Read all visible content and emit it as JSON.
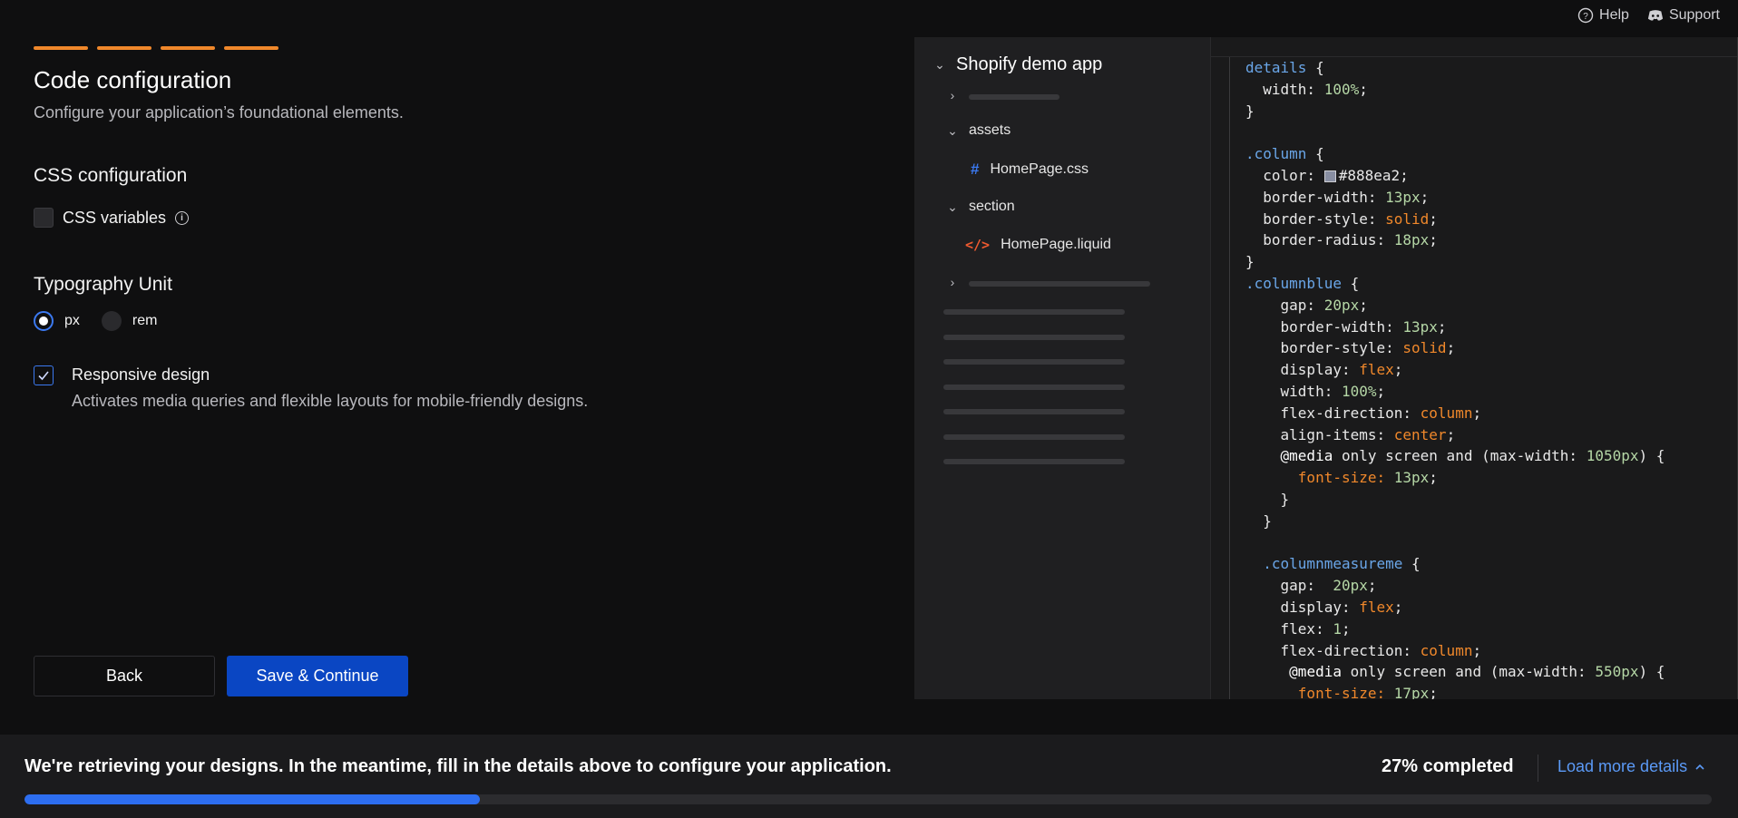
{
  "top_links": {
    "help": "Help",
    "support": "Support"
  },
  "steps": 4,
  "header": {
    "title": "Code configuration",
    "subtitle": "Configure your application’s foundational elements."
  },
  "css_config": {
    "title": "CSS configuration",
    "css_variables_label": "CSS variables",
    "css_variables_checked": false
  },
  "typography": {
    "title": "Typography Unit",
    "options": [
      "px",
      "rem"
    ],
    "selected": "px"
  },
  "responsive": {
    "title": "Responsive design",
    "description": "Activates media queries and flexible layouts for mobile-friendly designs.",
    "checked": true
  },
  "buttons": {
    "back": "Back",
    "save": "Save & Continue"
  },
  "file_tree": {
    "root": "Shopify demo app",
    "folders": [
      {
        "name": "assets",
        "files": [
          {
            "name": "HomePage.css",
            "icon": "hash-icon"
          }
        ]
      },
      {
        "name": "section",
        "files": [
          {
            "name": "HomePage.liquid",
            "icon": "code-tag-icon"
          }
        ]
      }
    ]
  },
  "code": {
    "lines": [
      [
        [
          "details",
          "sel"
        ],
        [
          " {",
          "txt"
        ]
      ],
      [
        [
          "  width: ",
          "txt"
        ],
        [
          "100%",
          "num"
        ],
        [
          ";",
          "txt"
        ]
      ],
      [
        [
          "}",
          "txt"
        ]
      ],
      [
        [
          "",
          "txt"
        ]
      ],
      [
        [
          ".column",
          "sel"
        ],
        [
          " {",
          "txt"
        ]
      ],
      [
        [
          "  color: ",
          "txt"
        ],
        [
          "#swatch",
          "swatch"
        ],
        [
          "#888ea2;",
          "txt"
        ]
      ],
      [
        [
          "  border-width: ",
          "txt"
        ],
        [
          "13px",
          "num"
        ],
        [
          ";",
          "txt"
        ]
      ],
      [
        [
          "  border-style: ",
          "txt"
        ],
        [
          "solid",
          "kw"
        ],
        [
          ";",
          "txt"
        ]
      ],
      [
        [
          "  border-radius: ",
          "txt"
        ],
        [
          "18px",
          "num"
        ],
        [
          ";",
          "txt"
        ]
      ],
      [
        [
          "}",
          "txt"
        ]
      ],
      [
        [
          ".columnblue",
          "sel"
        ],
        [
          " {",
          "txt"
        ]
      ],
      [
        [
          "    gap: ",
          "txt"
        ],
        [
          "20px",
          "num"
        ],
        [
          ";",
          "txt"
        ]
      ],
      [
        [
          "    border-width: ",
          "txt"
        ],
        [
          "13px",
          "num"
        ],
        [
          ";",
          "txt"
        ]
      ],
      [
        [
          "    border-style: ",
          "txt"
        ],
        [
          "solid",
          "kw"
        ],
        [
          ";",
          "txt"
        ]
      ],
      [
        [
          "    display: ",
          "txt"
        ],
        [
          "flex",
          "kw"
        ],
        [
          ";",
          "txt"
        ]
      ],
      [
        [
          "    width: ",
          "txt"
        ],
        [
          "100%",
          "num"
        ],
        [
          ";",
          "txt"
        ]
      ],
      [
        [
          "    flex-direction: ",
          "txt"
        ],
        [
          "column",
          "kw"
        ],
        [
          ";",
          "txt"
        ]
      ],
      [
        [
          "    align-items: ",
          "txt"
        ],
        [
          "center",
          "kw"
        ],
        [
          ";",
          "txt"
        ]
      ],
      [
        [
          "    ",
          "txt"
        ],
        [
          "@media",
          "at"
        ],
        [
          " only screen and (max-width: ",
          "txt"
        ],
        [
          "1050px",
          "num"
        ],
        [
          ") {",
          "txt"
        ]
      ],
      [
        [
          "      ",
          "txt"
        ],
        [
          "font-size: ",
          "kw"
        ],
        [
          "13px",
          "num"
        ],
        [
          ";",
          "txt"
        ]
      ],
      [
        [
          "    }",
          "txt"
        ]
      ],
      [
        [
          "  }",
          "txt"
        ]
      ],
      [
        [
          "",
          "txt"
        ]
      ],
      [
        [
          "  ",
          "txt"
        ],
        [
          ".columnmeasureme",
          "sel"
        ],
        [
          " {",
          "txt"
        ]
      ],
      [
        [
          "    gap:  ",
          "txt"
        ],
        [
          "20px",
          "num"
        ],
        [
          ";",
          "txt"
        ]
      ],
      [
        [
          "    display: ",
          "txt"
        ],
        [
          "flex",
          "kw"
        ],
        [
          ";",
          "txt"
        ]
      ],
      [
        [
          "    flex: ",
          "txt"
        ],
        [
          "1",
          "num"
        ],
        [
          ";",
          "txt"
        ]
      ],
      [
        [
          "    flex-direction: ",
          "txt"
        ],
        [
          "column",
          "kw"
        ],
        [
          ";",
          "txt"
        ]
      ],
      [
        [
          "     ",
          "txt"
        ],
        [
          "@media",
          "at"
        ],
        [
          " only screen and (max-width: ",
          "txt"
        ],
        [
          "550px",
          "num"
        ],
        [
          ") {",
          "txt"
        ]
      ],
      [
        [
          "      ",
          "txt"
        ],
        [
          "font-size: ",
          "kw"
        ],
        [
          "17px",
          "num"
        ],
        [
          ";",
          "txt"
        ]
      ]
    ]
  },
  "bottom": {
    "message": "We're retrieving your designs. In the meantime, fill in the details above to configure your application.",
    "percent_text": "27% completed",
    "progress": 0.27,
    "load_more": "Load more details"
  },
  "colors": {
    "accent_orange": "#f0882b",
    "primary_blue": "#0a46c3",
    "progress_blue": "#2d6ef0",
    "link_blue": "#5b9af7"
  }
}
